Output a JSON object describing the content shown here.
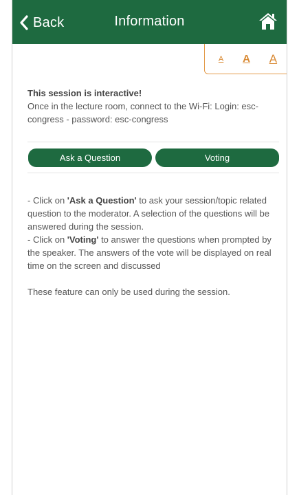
{
  "header": {
    "back_label": "Back",
    "title": "Information",
    "back_icon": "chevron-left-icon",
    "home_icon": "home-icon"
  },
  "font_sizes": {
    "small": "A",
    "medium": "A",
    "large": "A",
    "accent_color": "#d98a34"
  },
  "intro": {
    "title": "This session is interactive!",
    "text": "Once in the lecture room, connect to the Wi-Fi: Login: esc-congress - password: esc-congress"
  },
  "buttons": {
    "ask_label": "Ask a Question",
    "voting_label": "Voting"
  },
  "instructions": {
    "line1_prefix": "- Click on ",
    "line1_bold": "'Ask a Question'",
    "line1_suffix": " to ask your session/topic related question to the moderator. A selection of the questions will be answered during the session.",
    "line2_prefix": "- Click on ",
    "line2_bold": "'Voting'",
    "line2_suffix": " to answer the questions when prompted by the speaker. The answers of the vote will be displayed on real time on the screen and discussed",
    "note": "These feature can only be used during the session."
  },
  "colors": {
    "brand_green": "#1e6a40",
    "text_gray": "#555555"
  }
}
